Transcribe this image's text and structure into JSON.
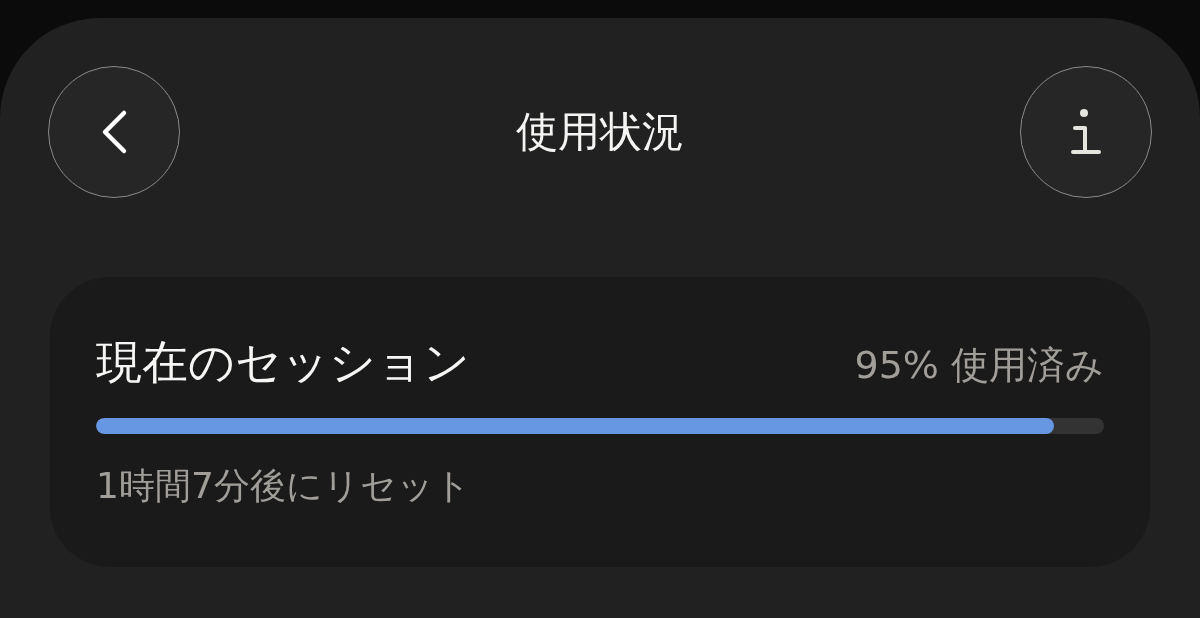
{
  "header": {
    "title": "使用状況"
  },
  "session": {
    "title": "現在のセッション",
    "usage": "95% 使用済み",
    "level": 0.95,
    "reset": "1時間7分後にリセット"
  }
}
